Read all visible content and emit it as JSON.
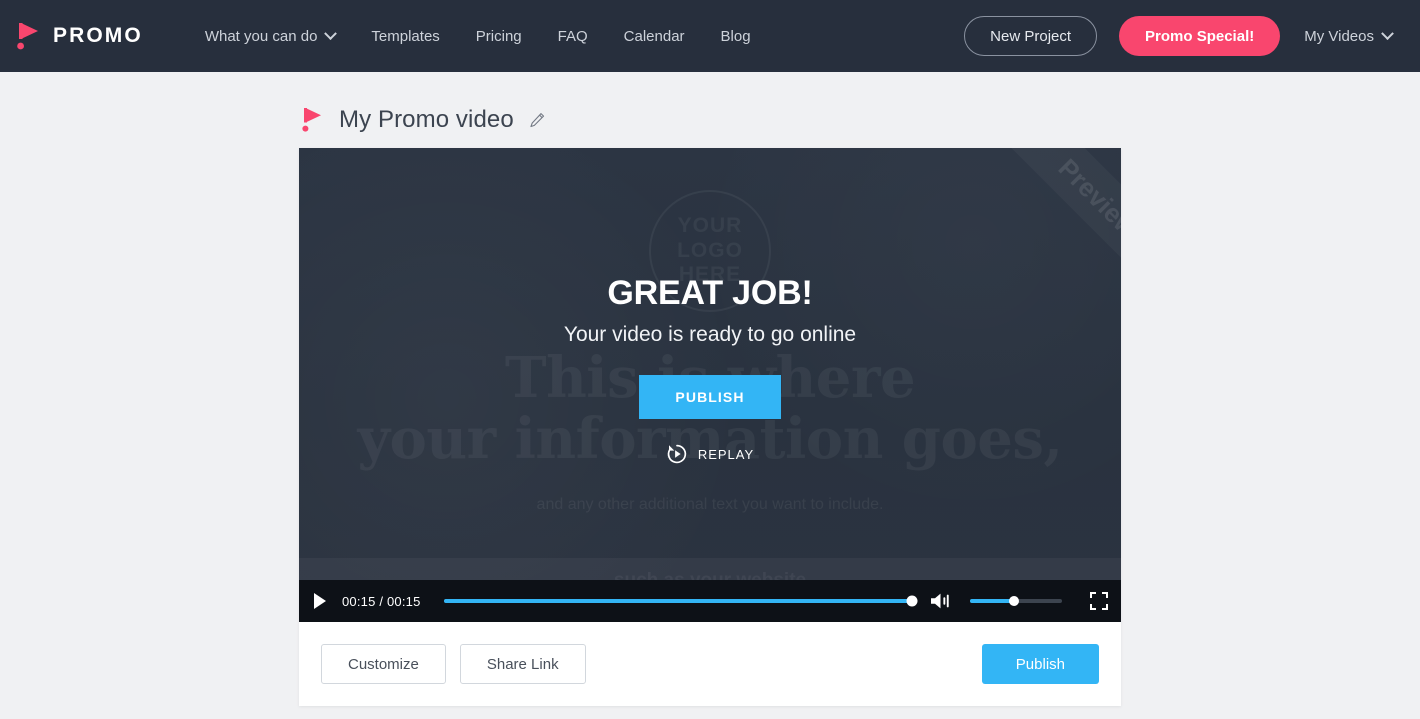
{
  "header": {
    "brand": {
      "word": "PROMO",
      "icon": "promo-play-logo-icon",
      "color": "#f9466e"
    },
    "nav": [
      {
        "label": "What you can do",
        "has_caret": true
      },
      {
        "label": "Templates",
        "has_caret": false
      },
      {
        "label": "Pricing",
        "has_caret": false
      },
      {
        "label": "FAQ",
        "has_caret": false
      },
      {
        "label": "Calendar",
        "has_caret": false
      },
      {
        "label": "Blog",
        "has_caret": false
      }
    ],
    "new_project_label": "New Project",
    "promo_special_label": "Promo Special!",
    "my_videos_label": "My Videos"
  },
  "project": {
    "title": "My Promo video",
    "edit_icon": "pencil-icon"
  },
  "video": {
    "ribbon_label": "Preview",
    "scene": {
      "logo_placeholder": [
        "YOUR",
        "LOGO",
        "HERE"
      ],
      "headline": "This is where\nyour information goes,",
      "subline": "and any other additional text you want to include.",
      "footline": "such as your website"
    },
    "overlay": {
      "title": "GREAT JOB!",
      "subtitle": "Your video is ready to go online",
      "publish_label": "PUBLISH",
      "replay_label": "REPLAY"
    },
    "controls": {
      "play_icon": "play-icon",
      "current_time": "00:15",
      "duration": "00:15",
      "time_display": "00:15 / 00:15",
      "progress_percent": 100,
      "volume_icon": "volume-on-icon",
      "volume_percent": 48,
      "fullscreen_icon": "fullscreen-icon",
      "accent_color": "#33b5f5"
    }
  },
  "actions": {
    "customize_label": "Customize",
    "share_link_label": "Share Link",
    "publish_label": "Publish"
  }
}
